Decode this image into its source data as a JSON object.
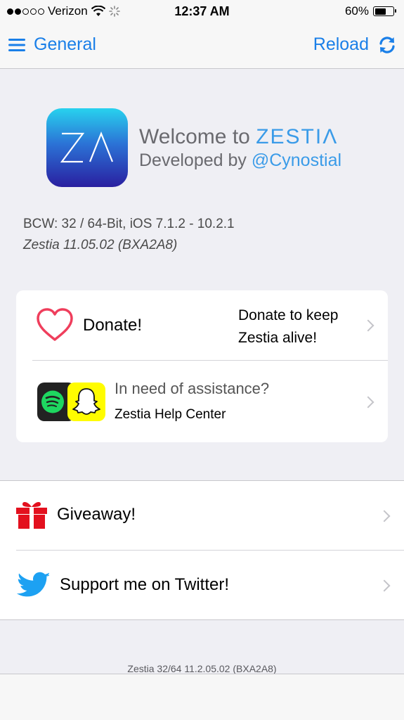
{
  "status": {
    "carrier": "Verizon",
    "signal_bars": 2,
    "time": "12:37 AM",
    "battery": "60%",
    "battery_level": 0.6
  },
  "nav": {
    "back_label": "General",
    "reload_label": "Reload",
    "accent_color": "#1a7fe8"
  },
  "header": {
    "logo_text": "ZΛ",
    "welcome_prefix": "Welcome to",
    "brand": "ZESTIΛ",
    "developed_prefix": "Developed by",
    "developer": "@Cynostial"
  },
  "info": {
    "compat": "BCW: 32 / 64-Bit, iOS 7.1.2 - 10.2.1",
    "version": "Zestia 11.05.02 (BXA2A8)"
  },
  "card": {
    "donate": {
      "label": "Donate!",
      "detail_line1": "Donate to keep",
      "detail_line2": "Zestia alive!",
      "icon": "heart-icon"
    },
    "help": {
      "title": "In need of assistance?",
      "subtitle": "Zestia Help Center",
      "icons": [
        "spotify-icon",
        "snapchat-icon"
      ]
    }
  },
  "group": {
    "giveaway": {
      "label": "Giveaway!",
      "icon": "gift-icon"
    },
    "twitter": {
      "label": "Support me on Twitter!",
      "icon": "twitter-bird-icon"
    }
  },
  "footer": {
    "text": "Zestia 32/64 11.2.05.02 (BXA2A8)"
  }
}
